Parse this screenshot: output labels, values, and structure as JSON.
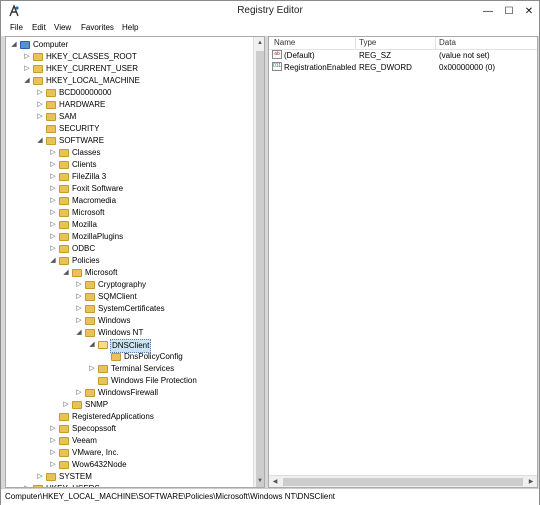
{
  "window": {
    "title": "Registry Editor"
  },
  "controls": {
    "minimize": "—",
    "maximize": "☐",
    "close": "✕"
  },
  "menu": {
    "file": "File",
    "edit": "Edit",
    "view": "View",
    "favorites": "Favorites",
    "help": "Help"
  },
  "tree": [
    {
      "label": "Computer",
      "exp": "◢",
      "folder": false
    },
    {
      "label": "HKEY_CLASSES_ROOT",
      "exp": "▷"
    },
    {
      "label": "HKEY_CURRENT_USER",
      "exp": "▷"
    },
    {
      "label": "HKEY_LOCAL_MACHINE",
      "exp": "◢"
    },
    {
      "label": "BCD00000000",
      "exp": "▷"
    },
    {
      "label": "HARDWARE",
      "exp": "▷"
    },
    {
      "label": "SAM",
      "exp": "▷"
    },
    {
      "label": "SECURITY",
      "exp": ""
    },
    {
      "label": "SOFTWARE",
      "exp": "◢"
    },
    {
      "label": "Classes",
      "exp": "▷"
    },
    {
      "label": "Clients",
      "exp": "▷"
    },
    {
      "label": "FileZilla 3",
      "exp": "▷"
    },
    {
      "label": "Foxit Software",
      "exp": "▷"
    },
    {
      "label": "Macromedia",
      "exp": "▷"
    },
    {
      "label": "Microsoft",
      "exp": "▷"
    },
    {
      "label": "Mozilla",
      "exp": "▷"
    },
    {
      "label": "MozillaPlugins",
      "exp": "▷"
    },
    {
      "label": "ODBC",
      "exp": "▷"
    },
    {
      "label": "Policies",
      "exp": "◢"
    },
    {
      "label": "Microsoft",
      "exp": "◢"
    },
    {
      "label": "Cryptography",
      "exp": "▷"
    },
    {
      "label": "SQMClient",
      "exp": "▷"
    },
    {
      "label": "SystemCertificates",
      "exp": "▷"
    },
    {
      "label": "Windows",
      "exp": "▷"
    },
    {
      "label": "Windows NT",
      "exp": "◢"
    },
    {
      "label": "DNSClient",
      "exp": "◢"
    },
    {
      "label": "DnsPolicyConfig",
      "exp": ""
    },
    {
      "label": "Terminal Services",
      "exp": "▷"
    },
    {
      "label": "Windows File Protection",
      "exp": ""
    },
    {
      "label": "WindowsFirewall",
      "exp": "▷"
    },
    {
      "label": "SNMP",
      "exp": "▷"
    },
    {
      "label": "RegisteredApplications",
      "exp": ""
    },
    {
      "label": "Specopssoft",
      "exp": "▷"
    },
    {
      "label": "Veeam",
      "exp": "▷"
    },
    {
      "label": "VMware, Inc.",
      "exp": "▷"
    },
    {
      "label": "Wow6432Node",
      "exp": "▷"
    },
    {
      "label": "SYSTEM",
      "exp": "▷"
    },
    {
      "label": "HKEY_USERS",
      "exp": "▷"
    }
  ],
  "list": {
    "headers": {
      "name": "Name",
      "type": "Type",
      "data": "Data"
    },
    "rows": [
      {
        "icon": "ab",
        "name": "(Default)",
        "type": "REG_SZ",
        "data": "(value not set)"
      },
      {
        "icon": "011",
        "name": "RegistrationEnabled",
        "type": "REG_DWORD",
        "data": "0x00000000 (0)"
      }
    ]
  },
  "status": "Computer\\HKEY_LOCAL_MACHINE\\SOFTWARE\\Policies\\Microsoft\\Windows NT\\DNSClient"
}
